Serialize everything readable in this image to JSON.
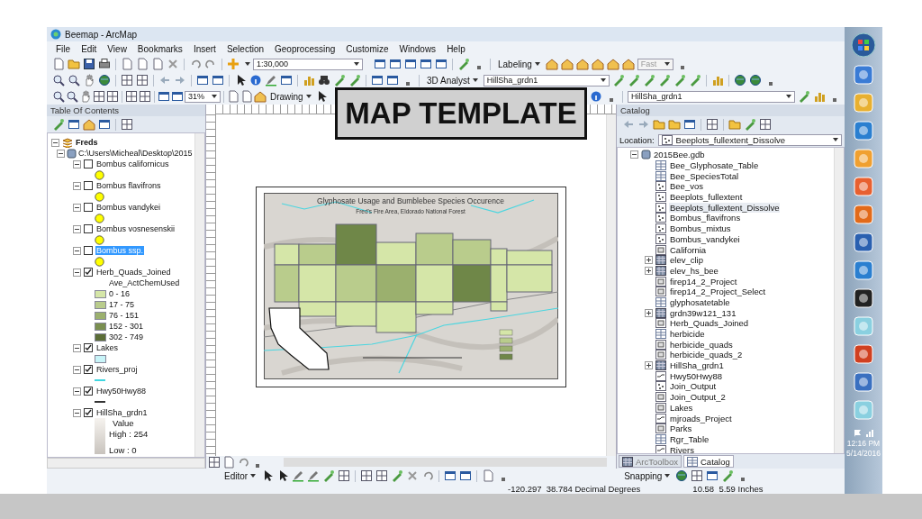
{
  "window": {
    "title": "Beemap - ArcMap"
  },
  "menu": [
    "File",
    "Edit",
    "View",
    "Bookmarks",
    "Insert",
    "Selection",
    "Geoprocessing",
    "Customize",
    "Windows",
    "Help"
  ],
  "toolbars": {
    "scale": "1:30,000",
    "labeling": "Labeling",
    "label_quality": "Fast",
    "analyst": "3D Analyst",
    "analyst_layer": "HillSha_grdn1",
    "zoom": "31%",
    "drawing": "Drawing",
    "effects_layer": "HillSha_grdn1"
  },
  "overlay_label": "MAP TEMPLATE",
  "toc": {
    "title": "Table Of Contents",
    "root": {
      "name": "Freds",
      "expanded": true,
      "children": [
        {
          "name": "C:\\Users\\Micheal\\Desktop\\2015",
          "expanded": true,
          "children": [
            {
              "name": "Bombus californicus",
              "kind": "points",
              "checked": false,
              "selected": false,
              "expanded": true,
              "color": "#ffff00"
            },
            {
              "name": "Bombus flavifrons",
              "kind": "points",
              "checked": false,
              "selected": false,
              "expanded": true,
              "color": "#ffff00"
            },
            {
              "name": "Bombus vandykei",
              "kind": "points",
              "checked": false,
              "selected": false,
              "expanded": true,
              "color": "#ffff00"
            },
            {
              "name": "Bombus vosnesenskii",
              "kind": "points",
              "checked": false,
              "selected": false,
              "expanded": true,
              "color": "#ffff00"
            },
            {
              "name": "Bombus ssp.",
              "kind": "points",
              "checked": false,
              "selected": true,
              "expanded": true,
              "color": "#ffff00"
            },
            {
              "name": "Herb_Quads_Joined",
              "kind": "classes",
              "checked": true,
              "selected": false,
              "expanded": true,
              "field": "Ave_ActChemUsed",
              "classes": [
                {
                  "label": "0 - 16",
                  "color": "#d5e6a8"
                },
                {
                  "label": "17 - 75",
                  "color": "#b9cc8c"
                },
                {
                  "label": "76 - 151",
                  "color": "#9bb06e"
                },
                {
                  "label": "152 - 301",
                  "color": "#7a8f50"
                },
                {
                  "label": "302 - 749",
                  "color": "#5b6d37"
                }
              ]
            },
            {
              "name": "Lakes",
              "kind": "fill",
              "checked": true,
              "selected": false,
              "expanded": true,
              "color": "#c8f4f8"
            },
            {
              "name": "Rivers_proj",
              "kind": "line",
              "checked": true,
              "selected": false,
              "expanded": true,
              "color": "#3fd6e0"
            },
            {
              "name": "Hwy50Hwy88",
              "kind": "line",
              "checked": true,
              "selected": false,
              "expanded": true,
              "color": "#333333"
            },
            {
              "name": "HillSha_grdn1",
              "kind": "raster",
              "checked": true,
              "selected": false,
              "expanded": true,
              "field": "Value",
              "high": "High : 254",
              "low": "Low : 0"
            }
          ]
        }
      ]
    }
  },
  "map": {
    "title": "Glyphosate Usage and Bumblebee Species Occurence",
    "subtitle": "Fred's Fire Area, Eldorado National Forest"
  },
  "catalog": {
    "title": "Catalog",
    "location_label": "Location:",
    "location": "Beeplots_fullextent_Dissolve",
    "root": {
      "name": "2015Bee.gdb",
      "expanded": true,
      "children": [
        {
          "name": "Bee_Glyphosate_Table",
          "kind": "table",
          "selected": false
        },
        {
          "name": "Bee_SpeciesTotal",
          "kind": "table",
          "selected": false
        },
        {
          "name": "Bee_vos",
          "kind": "points",
          "selected": false
        },
        {
          "name": "Beeplots_fullextent",
          "kind": "points",
          "selected": false
        },
        {
          "name": "Beeplots_fullextent_Dissolve",
          "kind": "points",
          "selected": true
        },
        {
          "name": "Bombus_flavifrons",
          "kind": "points",
          "selected": false
        },
        {
          "name": "Bombus_mixtus",
          "kind": "points",
          "selected": false
        },
        {
          "name": "Bombus_vandykei",
          "kind": "points",
          "selected": false
        },
        {
          "name": "California",
          "kind": "polygon",
          "selected": false
        },
        {
          "name": "elev_clip",
          "kind": "raster",
          "selected": false,
          "expanded": false
        },
        {
          "name": "elev_hs_bee",
          "kind": "raster",
          "selected": false,
          "expanded": false
        },
        {
          "name": "firep14_2_Project",
          "kind": "polygon",
          "selected": false
        },
        {
          "name": "firep14_2_Project_Select",
          "kind": "polygon",
          "selected": false
        },
        {
          "name": "glyphosatetable",
          "kind": "table",
          "selected": false
        },
        {
          "name": "grdn39w121_131",
          "kind": "raster",
          "selected": false,
          "expanded": false
        },
        {
          "name": "Herb_Quads_Joined",
          "kind": "polygon",
          "selected": false
        },
        {
          "name": "herbicide",
          "kind": "table",
          "selected": false
        },
        {
          "name": "herbicide_quads",
          "kind": "polygon",
          "selected": false
        },
        {
          "name": "herbicide_quads_2",
          "kind": "polygon",
          "selected": false
        },
        {
          "name": "HillSha_grdn1",
          "kind": "raster",
          "selected": false,
          "expanded": false
        },
        {
          "name": "Hwy50Hwy88",
          "kind": "line",
          "selected": false
        },
        {
          "name": "Join_Output",
          "kind": "points",
          "selected": false
        },
        {
          "name": "Join_Output_2",
          "kind": "polygon",
          "selected": false
        },
        {
          "name": "Lakes",
          "kind": "polygon",
          "selected": false
        },
        {
          "name": "mjroads_Project",
          "kind": "line",
          "selected": false
        },
        {
          "name": "Parks",
          "kind": "polygon",
          "selected": false
        },
        {
          "name": "Rgr_Table",
          "kind": "table",
          "selected": false
        },
        {
          "name": "Rivers",
          "kind": "line",
          "selected": false
        }
      ]
    },
    "tabs": [
      {
        "label": "ArcToolbox",
        "selected": false
      },
      {
        "label": "Catalog",
        "selected": true
      }
    ]
  },
  "editor": "Editor",
  "snapping": "Snapping",
  "status": {
    "coordinates": "-120.297  38.784 Decimal Degrees",
    "page": "10.58  5.59 Inches"
  },
  "clock": {
    "time": "12:16 PM",
    "date": "5/14/2016"
  }
}
